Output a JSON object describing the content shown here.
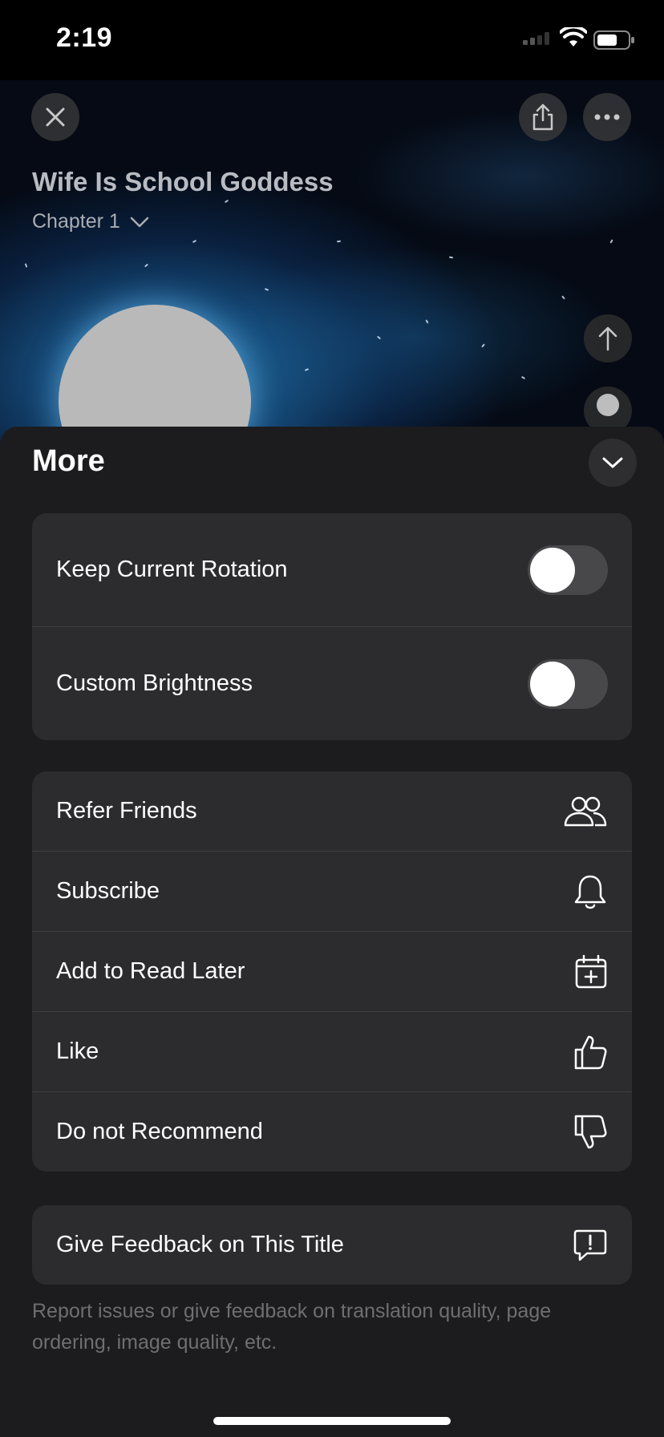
{
  "status_bar": {
    "time": "2:19"
  },
  "header": {
    "title": "Wife Is School Goddess",
    "chapter": "Chapter 1"
  },
  "icons": {
    "close": "close-icon",
    "share": "share-icon",
    "more": "ellipsis-icon",
    "scroll_up": "arrow-up-icon",
    "collapse": "chevron-down-icon"
  },
  "sheet": {
    "title": "More",
    "toggles": [
      {
        "label": "Keep Current Rotation",
        "on": false
      },
      {
        "label": "Custom Brightness",
        "on": false
      }
    ],
    "actions": [
      {
        "label": "Refer Friends",
        "icon": "people-icon"
      },
      {
        "label": "Subscribe",
        "icon": "bell-icon"
      },
      {
        "label": "Add to Read Later",
        "icon": "calendar-add-icon"
      },
      {
        "label": "Like",
        "icon": "thumbs-up-icon"
      },
      {
        "label": "Do not Recommend",
        "icon": "thumbs-down-icon"
      }
    ],
    "feedback": {
      "label": "Give Feedback on This Title",
      "icon": "feedback-icon"
    },
    "note": "Report issues or give feedback on translation quality, page ordering, image quality, etc."
  },
  "colors": {
    "sheet_bg": "#1c1c1e",
    "group_bg": "#2c2c2e",
    "toggle_off": "#48484a",
    "note_text": "#6e6e73"
  }
}
